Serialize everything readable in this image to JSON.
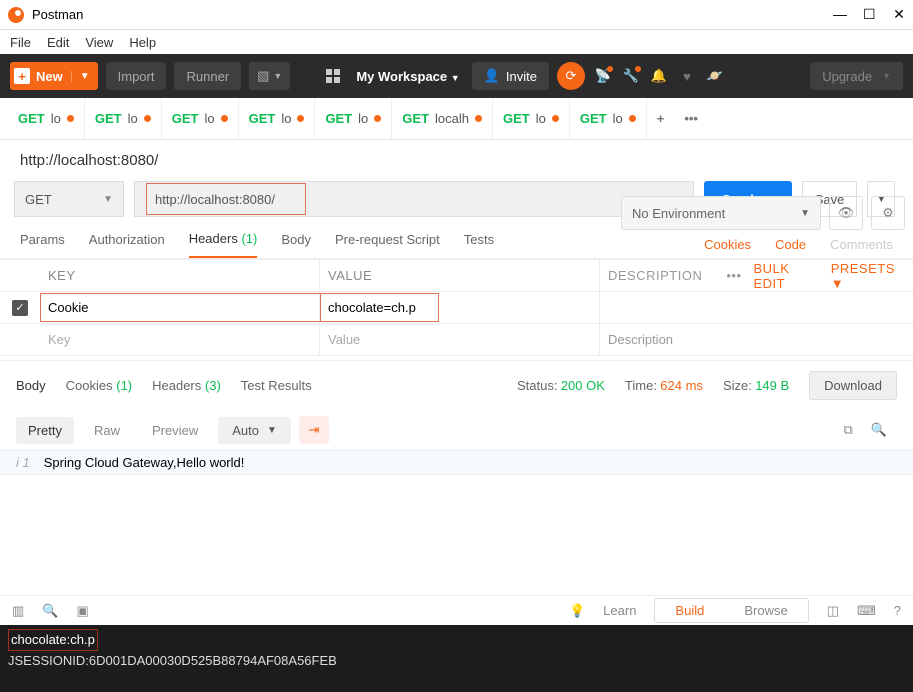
{
  "window": {
    "title": "Postman"
  },
  "menu": [
    "File",
    "Edit",
    "View",
    "Help"
  ],
  "toolbar": {
    "new": "New",
    "import": "Import",
    "runner": "Runner",
    "workspace": "My Workspace",
    "invite": "Invite",
    "upgrade": "Upgrade"
  },
  "env": {
    "selected": "No Environment"
  },
  "tabs": [
    {
      "method": "GET",
      "label": "lo"
    },
    {
      "method": "GET",
      "label": "lo"
    },
    {
      "method": "GET",
      "label": "lo"
    },
    {
      "method": "GET",
      "label": "lo"
    },
    {
      "method": "GET",
      "label": "lo"
    },
    {
      "method": "GET",
      "label": "localh"
    },
    {
      "method": "GET",
      "label": "lo"
    },
    {
      "method": "GET",
      "label": "lo"
    }
  ],
  "request": {
    "title": "http://localhost:8080/",
    "method": "GET",
    "url": "http://localhost:8080/",
    "send": "Send",
    "save": "Save"
  },
  "reqTabs": {
    "params": "Params",
    "auth": "Authorization",
    "headers": "Headers",
    "headersCount": "(1)",
    "body": "Body",
    "prereq": "Pre-request Script",
    "tests": "Tests",
    "cookies": "Cookies",
    "code": "Code",
    "comments": "Comments"
  },
  "headerTable": {
    "cols": {
      "key": "KEY",
      "value": "VALUE",
      "desc": "DESCRIPTION"
    },
    "bulk": "Bulk Edit",
    "presets": "Presets",
    "row": {
      "key": "Cookie",
      "value": "chocolate=ch.p"
    },
    "ph": {
      "key": "Key",
      "value": "Value",
      "desc": "Description"
    }
  },
  "respTabs": {
    "body": "Body",
    "cookies": "Cookies",
    "cookiesCount": "(1)",
    "headers": "Headers",
    "headersCount": "(3)",
    "tests": "Test Results"
  },
  "respMeta": {
    "statusLabel": "Status:",
    "status": "200 OK",
    "timeLabel": "Time:",
    "time": "624 ms",
    "sizeLabel": "Size:",
    "size": "149 B",
    "download": "Download"
  },
  "bodyTools": {
    "pretty": "Pretty",
    "raw": "Raw",
    "preview": "Preview",
    "auto": "Auto"
  },
  "responseBody": "Spring Cloud Gateway,Hello world!",
  "footer": {
    "learn": "Learn",
    "build": "Build",
    "browse": "Browse"
  },
  "terminal": {
    "line1": "chocolate:ch.p",
    "line2": "JSESSIONID:6D001DA00030D525B88794AF08A56FEB"
  }
}
